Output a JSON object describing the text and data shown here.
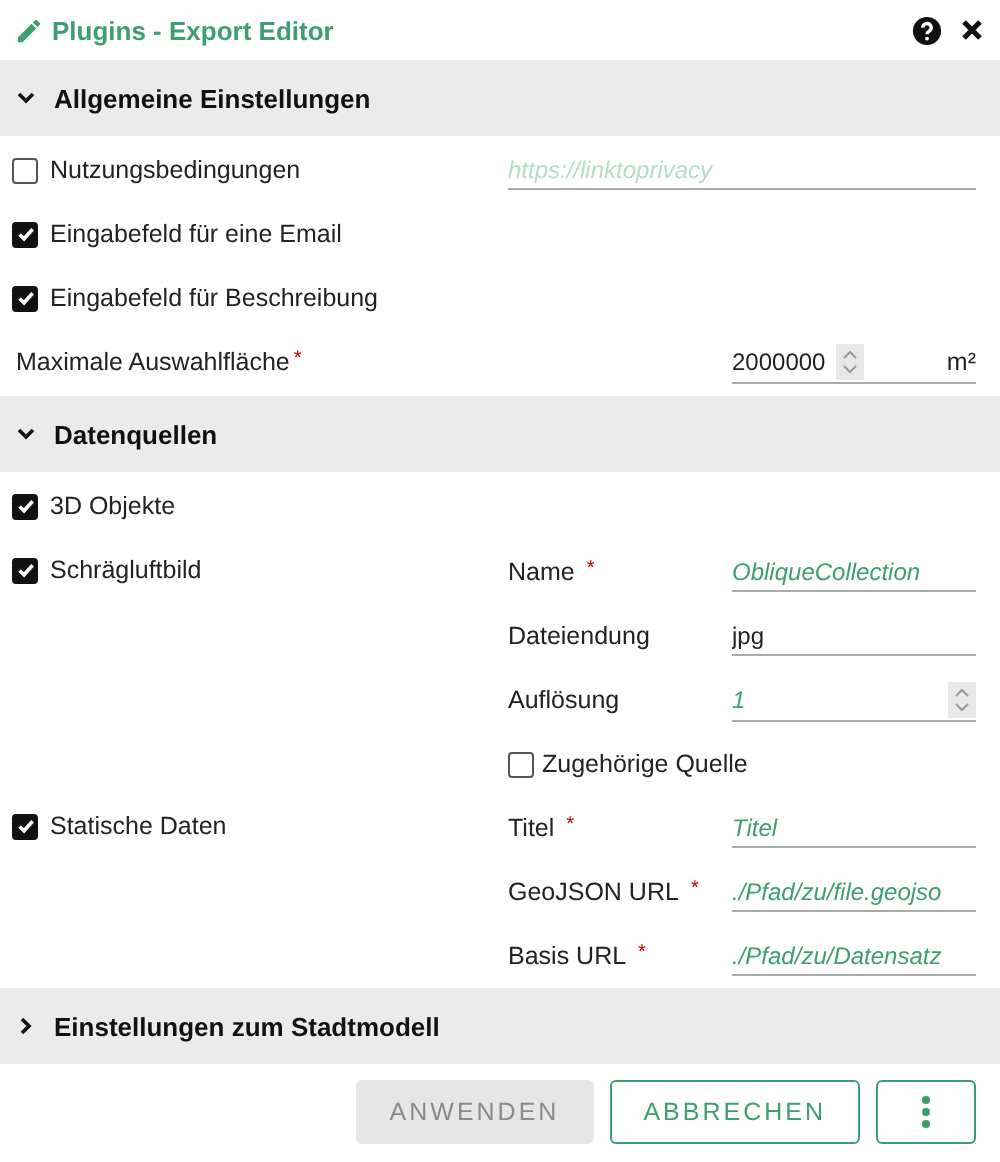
{
  "header": {
    "title": "Plugins - Export Editor"
  },
  "sections": [
    {
      "title": "Allgemeine Einstellungen",
      "expanded": true,
      "rows": [
        {
          "kind": "checkbox",
          "label": "Nutzungsbedingungen",
          "checked": false,
          "field": {
            "placeholder": "https://linktoprivacy",
            "disabled": true
          }
        },
        {
          "kind": "checkbox",
          "label": "Eingabefeld für eine Email",
          "checked": true
        },
        {
          "kind": "checkbox",
          "label": "Eingabefeld für Beschreibung",
          "checked": true
        },
        {
          "kind": "number",
          "label": "Maximale Auswahlfläche",
          "required_mark": "*",
          "value": "2000000",
          "unit": "m²"
        }
      ]
    },
    {
      "title": "Datenquellen",
      "expanded": true,
      "rows": [
        {
          "kind": "checkbox",
          "label": "3D Objekte",
          "checked": true
        },
        {
          "kind": "checkbox",
          "label": "Schrägluftbild",
          "checked": true,
          "subfields": [
            {
              "kind": "text",
              "label": "Name",
              "required_mark": "*",
              "placeholder": "ObliqueCollection"
            },
            {
              "kind": "text",
              "label": "Dateiendung",
              "value": "jpg"
            },
            {
              "kind": "number",
              "label": "Auflösung",
              "placeholder": "1"
            },
            {
              "kind": "checkbox",
              "label": "Zugehörige Quelle",
              "checked": false
            }
          ]
        },
        {
          "kind": "checkbox",
          "label": "Statische Daten",
          "checked": true,
          "subfields": [
            {
              "kind": "text",
              "label": "Titel",
              "required_mark": "*",
              "placeholder": "Titel"
            },
            {
              "kind": "text",
              "label": "GeoJSON URL",
              "required_mark": "*",
              "placeholder": "./Pfad/zu/file.geojso"
            },
            {
              "kind": "text",
              "label": "Basis URL",
              "required_mark": "*",
              "placeholder": "./Pfad/zu/Datensatz"
            }
          ]
        }
      ]
    },
    {
      "title": "Einstellungen zum Stadtmodell",
      "expanded": false
    }
  ],
  "buttons": [
    {
      "kind": "text",
      "label": "ANWENDEN",
      "disabled": true
    },
    {
      "kind": "text",
      "label": "ABBRECHEN",
      "disabled": false
    },
    {
      "kind": "menu",
      "disabled": false
    }
  ]
}
